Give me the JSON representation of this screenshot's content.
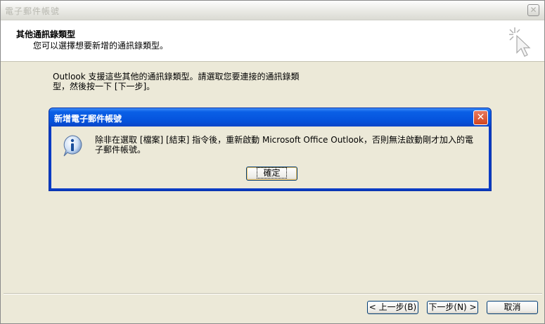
{
  "window": {
    "title": "電子郵件帳號",
    "close_glyph": "✕"
  },
  "header": {
    "title": "其他通訊錄類型",
    "subtitle": "您可以選擇想要新增的通訊錄類型。",
    "icon": "wizard-cursor-icon"
  },
  "body": {
    "text": "Outlook 支援這些其他的通訊錄類型。請選取您要連接的通訊錄類型，然後按一下 [下一步]。"
  },
  "dialog": {
    "title": "新增電子郵件帳號",
    "close_glyph": "✕",
    "icon": "info-icon",
    "message": "除非在選取 [檔案] [結束] 指令後，重新啟動 Microsoft Office Outlook，否則無法啟動剛才加入的電子郵件帳號。",
    "ok_label": "確定"
  },
  "buttons": {
    "back": "< 上一步(B)",
    "next": "下一步(N) >",
    "cancel": "取消"
  },
  "colors": {
    "dialog_title_blue": "#0553dc",
    "dialog_close_red": "#d2451f",
    "window_face": "#ece9d8"
  }
}
